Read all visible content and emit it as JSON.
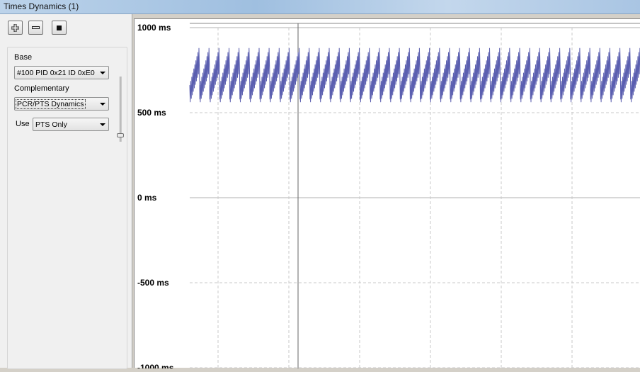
{
  "window": {
    "title": "Times Dynamics (1)"
  },
  "toolbar": {
    "add_icon": "plus-icon",
    "remove_icon": "minus-icon",
    "stop_icon": "stop-square-icon"
  },
  "panel": {
    "base_label": "Base",
    "base_value": "#100 PID 0x21 ID 0xE0",
    "complementary_label": "Complementary",
    "complementary_value": "PCR/PTS Dynamics",
    "use_label": "Use",
    "use_value": "PTS Only"
  },
  "chart_data": {
    "type": "line",
    "ylim": [
      -1000,
      1000
    ],
    "yticks": [
      "1000 ms",
      "500 ms",
      "0 ms",
      "-500 ms",
      "-1000 ms"
    ],
    "grid": true,
    "series_color": "#5b5fb0",
    "sawtooth": {
      "cycles": 45,
      "min_ms": 545,
      "max_ms": 880
    }
  }
}
